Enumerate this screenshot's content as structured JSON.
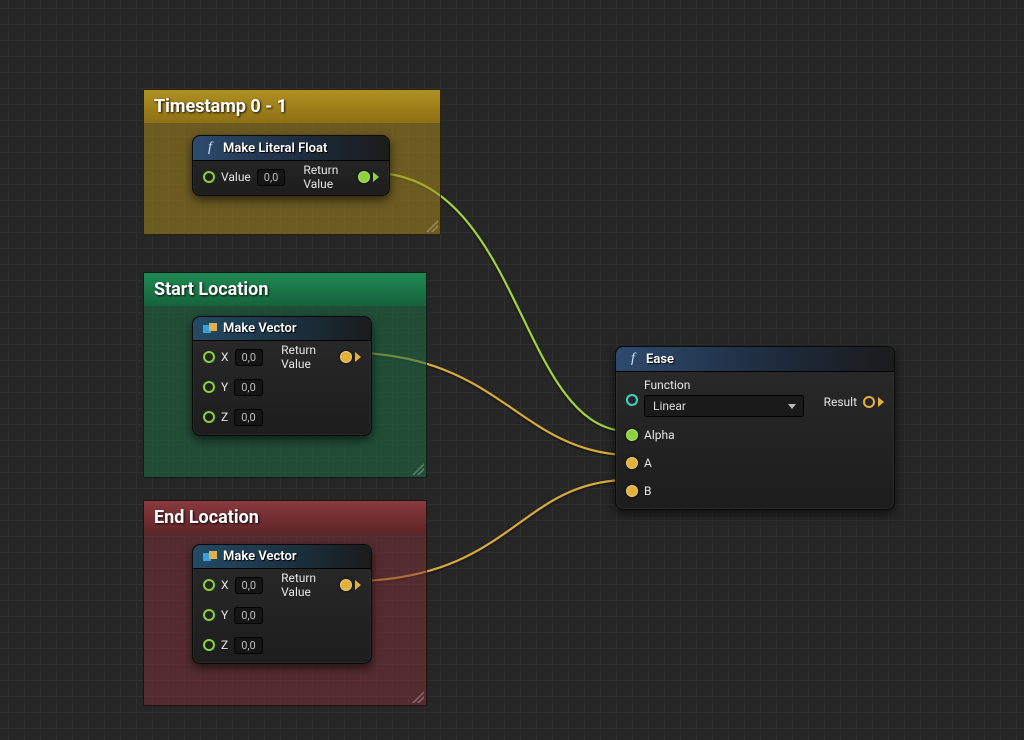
{
  "comments": {
    "timestamp": {
      "title": "Timestamp 0 - 1"
    },
    "start": {
      "title": "Start Location"
    },
    "end": {
      "title": "End Location"
    }
  },
  "nodes": {
    "literalFloat": {
      "title": "Make Literal Float",
      "inputs": {
        "value": {
          "label": "Value",
          "value": "0,0"
        }
      },
      "outputs": {
        "return": {
          "label": "Return Value"
        }
      }
    },
    "makeVectorStart": {
      "title": "Make Vector",
      "inputs": {
        "x": {
          "label": "X",
          "value": "0,0"
        },
        "y": {
          "label": "Y",
          "value": "0,0"
        },
        "z": {
          "label": "Z",
          "value": "0,0"
        }
      },
      "outputs": {
        "return": {
          "label": "Return Value"
        }
      }
    },
    "makeVectorEnd": {
      "title": "Make Vector",
      "inputs": {
        "x": {
          "label": "X",
          "value": "0,0"
        },
        "y": {
          "label": "Y",
          "value": "0,0"
        },
        "z": {
          "label": "Z",
          "value": "0,0"
        }
      },
      "outputs": {
        "return": {
          "label": "Return Value"
        }
      }
    },
    "ease": {
      "title": "Ease",
      "inputs": {
        "target": {
          "label": ""
        },
        "function": {
          "label": "Function",
          "value": "Linear"
        },
        "alpha": {
          "label": "Alpha"
        },
        "a": {
          "label": "A"
        },
        "b": {
          "label": "B"
        }
      },
      "outputs": {
        "result": {
          "label": "Result"
        }
      }
    }
  },
  "colors": {
    "wire_float": "#a3d43c",
    "wire_struct": "#d9ab3a"
  }
}
